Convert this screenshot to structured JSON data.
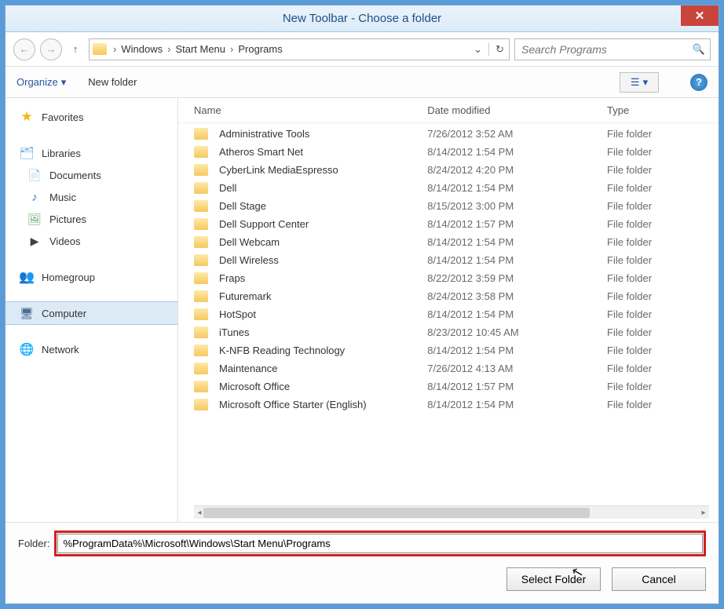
{
  "title": "New Toolbar - Choose a folder",
  "breadcrumb": [
    "Windows",
    "Start Menu",
    "Programs"
  ],
  "search_placeholder": "Search Programs",
  "toolbar": {
    "organize": "Organize",
    "newfolder": "New folder"
  },
  "sidebar": {
    "favorites": "Favorites",
    "libraries": "Libraries",
    "documents": "Documents",
    "music": "Music",
    "pictures": "Pictures",
    "videos": "Videos",
    "homegroup": "Homegroup",
    "computer": "Computer",
    "network": "Network"
  },
  "columns": {
    "name": "Name",
    "date": "Date modified",
    "type": "Type"
  },
  "rows": [
    {
      "name": "Administrative Tools",
      "date": "7/26/2012 3:52 AM",
      "type": "File folder"
    },
    {
      "name": "Atheros Smart Net",
      "date": "8/14/2012 1:54 PM",
      "type": "File folder"
    },
    {
      "name": "CyberLink MediaEspresso",
      "date": "8/24/2012 4:20 PM",
      "type": "File folder"
    },
    {
      "name": "Dell",
      "date": "8/14/2012 1:54 PM",
      "type": "File folder"
    },
    {
      "name": "Dell Stage",
      "date": "8/15/2012 3:00 PM",
      "type": "File folder"
    },
    {
      "name": "Dell Support Center",
      "date": "8/14/2012 1:57 PM",
      "type": "File folder"
    },
    {
      "name": "Dell Webcam",
      "date": "8/14/2012 1:54 PM",
      "type": "File folder"
    },
    {
      "name": "Dell Wireless",
      "date": "8/14/2012 1:54 PM",
      "type": "File folder"
    },
    {
      "name": "Fraps",
      "date": "8/22/2012 3:59 PM",
      "type": "File folder"
    },
    {
      "name": "Futuremark",
      "date": "8/24/2012 3:58 PM",
      "type": "File folder"
    },
    {
      "name": "HotSpot",
      "date": "8/14/2012 1:54 PM",
      "type": "File folder"
    },
    {
      "name": "iTunes",
      "date": "8/23/2012 10:45 AM",
      "type": "File folder"
    },
    {
      "name": "K-NFB Reading Technology",
      "date": "8/14/2012 1:54 PM",
      "type": "File folder"
    },
    {
      "name": "Maintenance",
      "date": "7/26/2012 4:13 AM",
      "type": "File folder"
    },
    {
      "name": "Microsoft Office",
      "date": "8/14/2012 1:57 PM",
      "type": "File folder"
    },
    {
      "name": "Microsoft Office Starter (English)",
      "date": "8/14/2012 1:54 PM",
      "type": "File folder"
    }
  ],
  "footer": {
    "label": "Folder:",
    "value": "%ProgramData%\\Microsoft\\Windows\\Start Menu\\Programs",
    "select": "Select Folder",
    "cancel": "Cancel"
  }
}
